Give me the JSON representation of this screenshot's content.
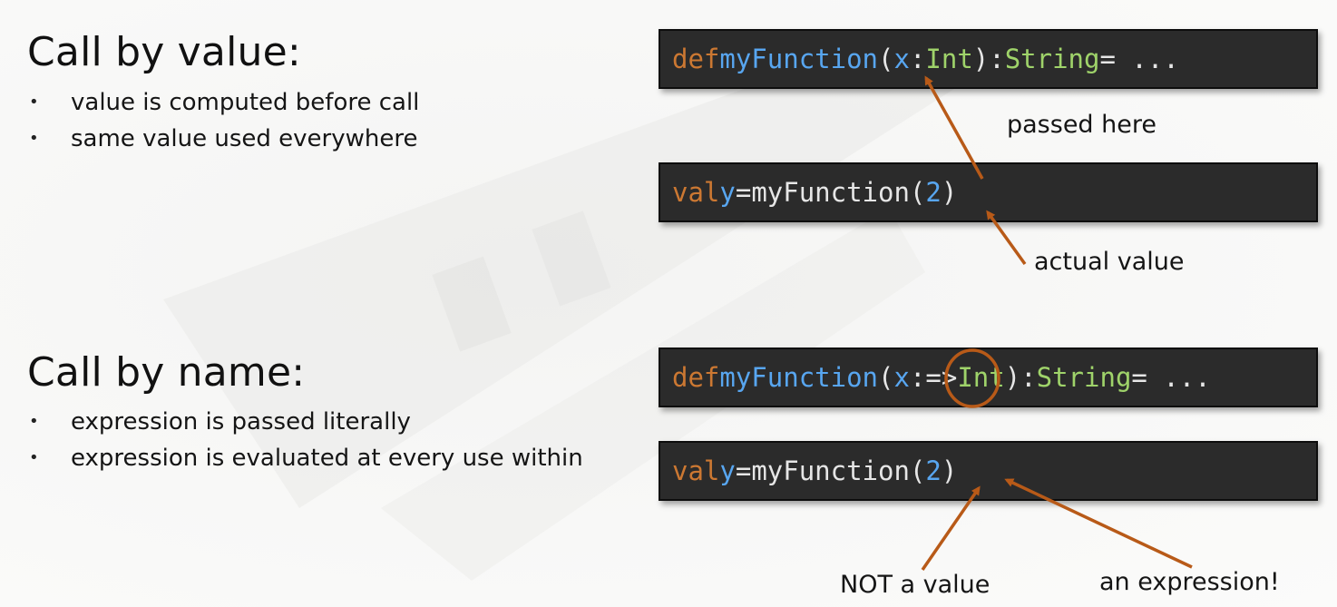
{
  "by_value": {
    "title": "Call by value:",
    "bullets": [
      "value is computed before call",
      "same value used everywhere"
    ],
    "code_def": {
      "kw": "def",
      "fn": "myFunction",
      "open": "(",
      "param": "x",
      "colon": ":",
      "type": "Int",
      "close": "):",
      "ret_type": "String",
      "rest": "= ..."
    },
    "code_call": {
      "kw": "val",
      "var": "y",
      "eq": "=",
      "call": "myFunction(",
      "arg": "2",
      "end": ")"
    },
    "note_passed": "passed here",
    "note_actual": "actual value"
  },
  "by_name": {
    "title": "Call by name:",
    "bullets": [
      "expression is passed literally",
      "expression is evaluated at every use within"
    ],
    "code_def": {
      "kw": "def",
      "fn": "myFunction",
      "open": "(",
      "param": "x",
      "colon": ":",
      "arrow": "=>",
      "type": "Int",
      "close": "):",
      "ret_type": "String",
      "rest": "= ..."
    },
    "code_call": {
      "kw": "val",
      "var": "y",
      "eq": "=",
      "call": "myFunction(",
      "arg": "2",
      "end": ")"
    },
    "note_not_value": "NOT a value",
    "note_expression": "an expression!"
  },
  "colors": {
    "annotation": "#b85a18",
    "keyword": "#cc7832",
    "identifier": "#58a6f0",
    "type": "#9fd36a",
    "code_bg": "#2b2b2b"
  }
}
